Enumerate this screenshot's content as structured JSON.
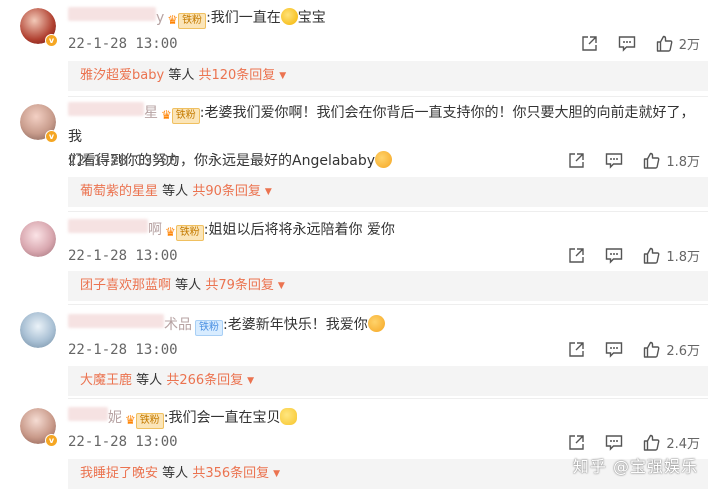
{
  "comments": [
    {
      "username_visible": "y",
      "fan_badge": "铁粉",
      "text": ":我们一直在",
      "text_after_emoji": "宝宝",
      "time": "22-1-28 13:00",
      "likes": "2万",
      "reply_names": "雅汐超爱baby",
      "reply_deng": "等人",
      "reply_total": "共120条回复"
    },
    {
      "username_visible": "星",
      "fan_badge": "铁粉",
      "text": ":老婆我们爱你啊！我们会在你背后一直支持你的！你只要大胆的向前走就好了，我",
      "text_line2": "们看得到你的努力，你永远是最好的Angelababy",
      "time": "22-1-28 13:00",
      "likes": "1.8万",
      "reply_names": "葡萄紫的星星",
      "reply_deng": "等人",
      "reply_total": "共90条回复"
    },
    {
      "username_visible": "啊",
      "fan_badge": "铁粉",
      "text": ":姐姐以后将将永远陪着你 爱你",
      "time": "22-1-28 13:00",
      "likes": "1.8万",
      "reply_names": "团子喜欢那蓝啊",
      "reply_deng": "等人",
      "reply_total": "共79条回复"
    },
    {
      "username_visible": "术品",
      "fan_badge": "铁粉",
      "text": ":老婆新年快乐！我爱你",
      "time": "22-1-28 13:00",
      "likes": "2.6万",
      "reply_names": "大魔王鹿",
      "reply_deng": "等人",
      "reply_total": "共266条回复"
    },
    {
      "username_visible": "妮",
      "fan_badge": "铁粉",
      "text": ":我们会一直在宝贝",
      "time": "22-1-28 13:00",
      "likes": "2.4万",
      "reply_names": "我睡捉了晚安",
      "reply_deng": "等人",
      "reply_total": "共356条回复"
    }
  ],
  "icons": {
    "share": "share-icon",
    "comment": "comment-icon",
    "like": "thumbs-up-icon",
    "expand": "triangle-down-icon"
  },
  "watermark": "知乎 @宝强娱乐",
  "colors": {
    "accent": "#eb7350",
    "reply_bg": "#f4f4f4",
    "fan_badge_bg": "#fbe5b8"
  }
}
